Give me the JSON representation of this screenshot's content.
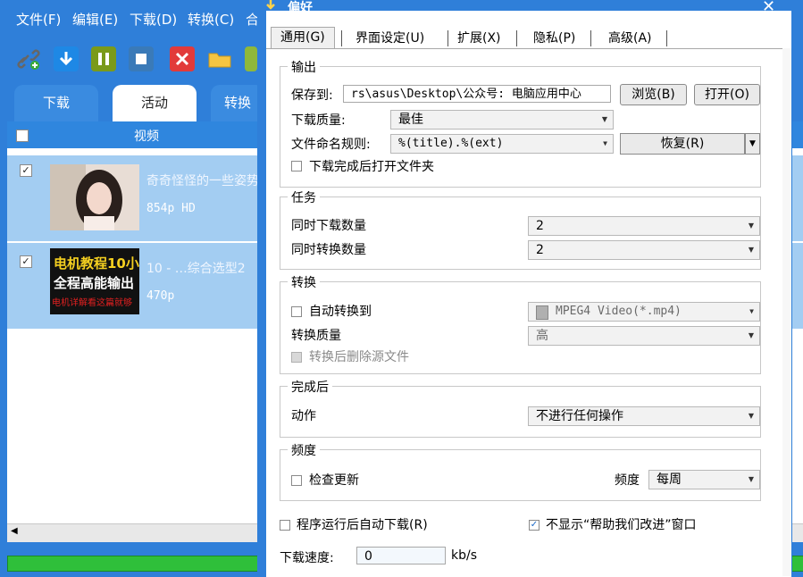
{
  "app": {
    "menu": [
      "文件(F)",
      "编辑(E)",
      "下载(D)",
      "转换(C)",
      "合"
    ],
    "tabs": [
      "下载",
      "活动",
      "转换"
    ],
    "list_header": "视频",
    "rows": [
      {
        "title": "奇奇怪怪的一些姿势",
        "meta": "854p HD",
        "checked": true,
        "thumb_text": []
      },
      {
        "title": "10 - …综合选型2",
        "meta": "470p",
        "checked": true,
        "thumb_text": [
          "电机教程10小",
          "全程高能输出",
          "电机详解看这篇就够"
        ]
      }
    ],
    "toolbar_icons": [
      "add-link-icon",
      "download-icon",
      "pause-icon",
      "stop-icon",
      "delete-icon",
      "folder-icon",
      "play-icon"
    ]
  },
  "dialog": {
    "title": "偏好",
    "tabs": [
      "通用(G)",
      "界面设定(U)",
      "扩展(X)",
      "隐私(P)",
      "高级(A)"
    ],
    "output": {
      "group": "输出",
      "save_to_label": "保存到:",
      "save_to_value": "rs\\asus\\Desktop\\公众号: 电脑应用中心",
      "browse": "浏览(B)",
      "open": "打开(O)",
      "quality_label": "下载质量:",
      "quality_value": "最佳",
      "naming_label": "文件命名规则:",
      "naming_value": "%(title).%(ext)",
      "restore": "恢复(R)",
      "open_folder_after": "下载完成后打开文件夹",
      "open_folder_after_checked": false
    },
    "tasks": {
      "group": "任务",
      "concurrent_dl_label": "同时下载数量",
      "concurrent_dl_value": "2",
      "concurrent_conv_label": "同时转换数量",
      "concurrent_conv_value": "2"
    },
    "convert": {
      "group": "转换",
      "auto_convert_label": "自动转换到",
      "auto_convert_checked": false,
      "auto_convert_value": "MPEG4 Video(*.mp4)",
      "quality_label": "转换质量",
      "quality_value": "高",
      "delete_source_label": "转换后删除源文件",
      "delete_source_checked": false
    },
    "after": {
      "group": "完成后",
      "action_label": "动作",
      "action_value": "不进行任何操作"
    },
    "frequency": {
      "group": "频度",
      "check_updates_label": "检查更新",
      "check_updates_checked": false,
      "freq_label": "频度",
      "freq_value": "每周"
    },
    "auto_download_label": "程序运行后自动下载(R)",
    "auto_download_checked": false,
    "hide_help_label": "不显示“帮助我们改进”窗口",
    "hide_help_checked": true,
    "speed_label": "下载速度:",
    "speed_value": "0",
    "speed_unit": "kb/s"
  }
}
